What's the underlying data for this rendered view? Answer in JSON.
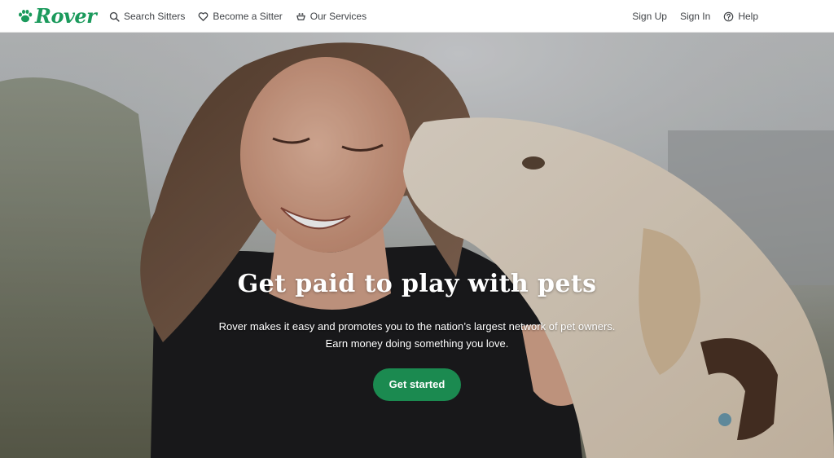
{
  "brand": {
    "name": "Rover",
    "color": "#1b9a5c"
  },
  "nav": {
    "left": [
      {
        "label": "Search Sitters",
        "icon": "search-icon"
      },
      {
        "label": "Become a Sitter",
        "icon": "heart-icon"
      },
      {
        "label": "Our Services",
        "icon": "dog-bowl-icon"
      }
    ],
    "right": [
      {
        "label": "Sign Up"
      },
      {
        "label": "Sign In"
      },
      {
        "label": "Help",
        "icon": "help-circle-icon"
      }
    ]
  },
  "hero": {
    "title": "Get paid to play with pets",
    "subtitle_line1": "Rover makes it easy and promotes you to the nation’s largest network of pet owners.",
    "subtitle_line2": "Earn money doing something you love.",
    "cta_label": "Get started",
    "cta_color": "#1b8a50"
  }
}
